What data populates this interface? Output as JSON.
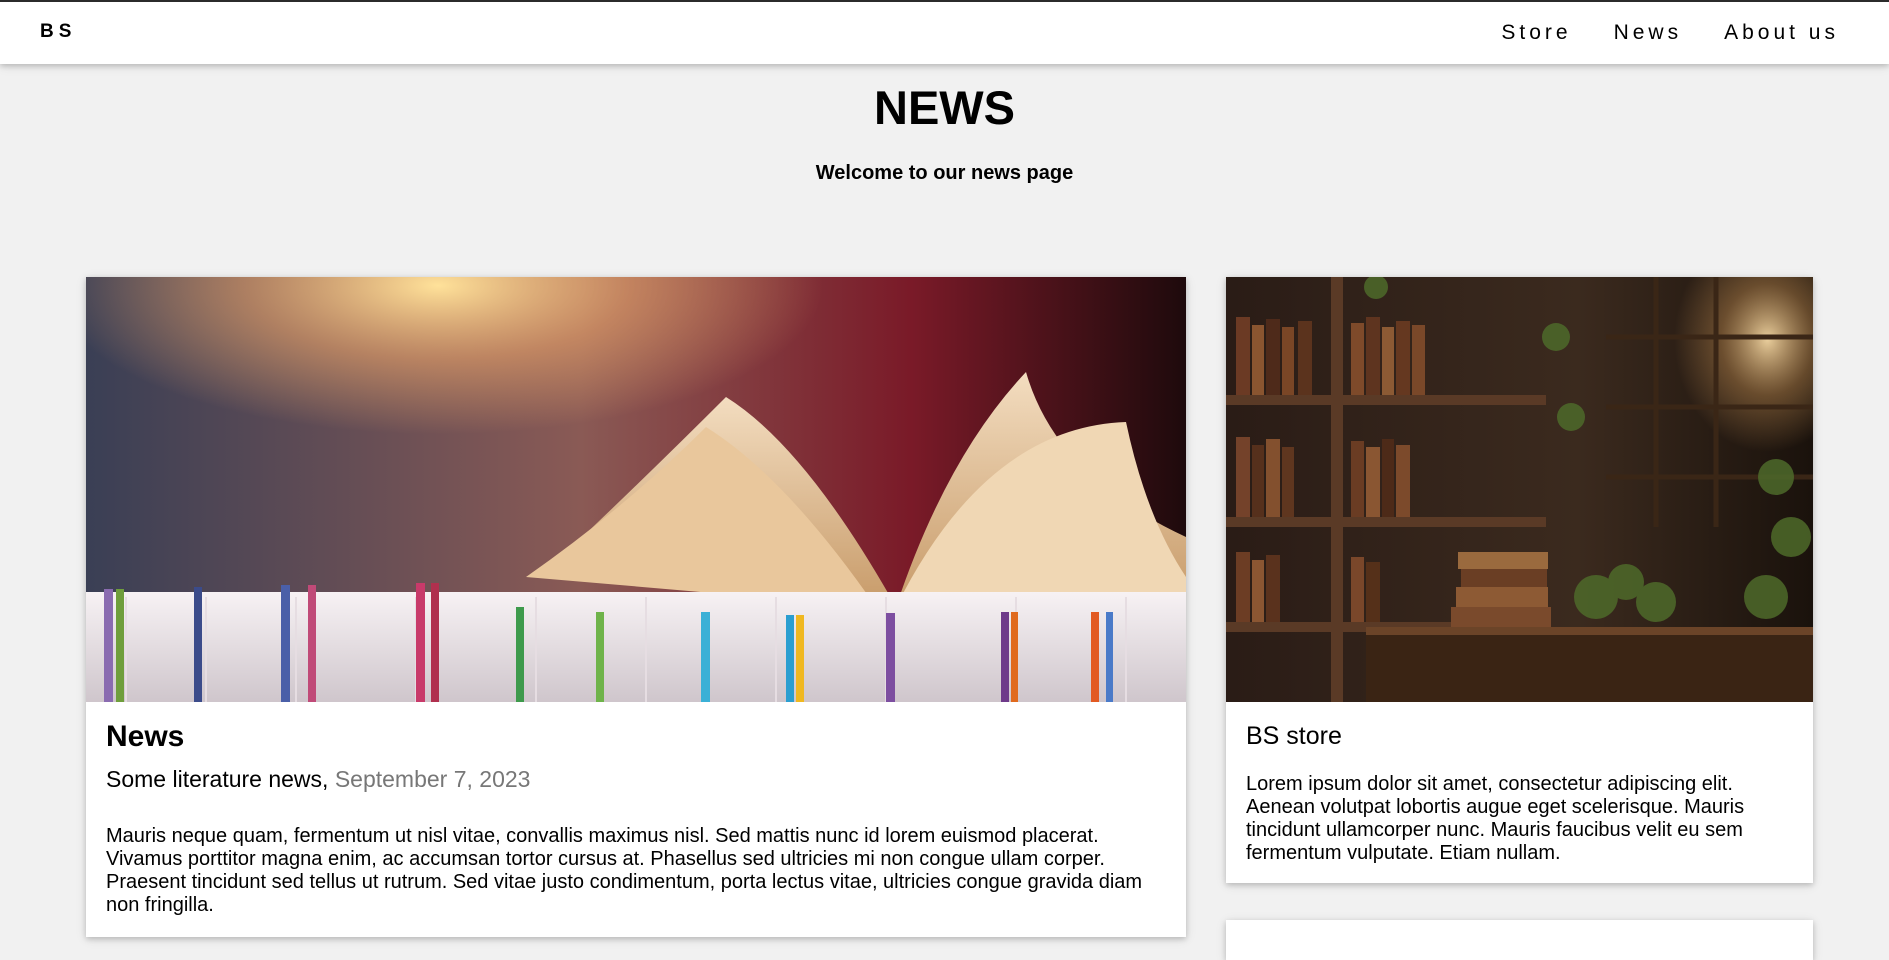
{
  "header": {
    "brand": "BS",
    "nav": [
      {
        "label": "Store"
      },
      {
        "label": "News"
      },
      {
        "label": "About us"
      }
    ]
  },
  "hero": {
    "title": "NEWS",
    "subtitle": "Welcome to our news page"
  },
  "main_card": {
    "image_icon": "open-book-photo",
    "title": "News",
    "subtitle": "Some literature news,",
    "date": "September 7, 2023",
    "text": "Mauris neque quam, fermentum ut nisl vitae, convallis maximus nisl. Sed mattis nunc id lorem euismod placerat. Vivamus porttitor magna enim, ac accumsan tortor cursus at. Phasellus sed ultricies mi non congue ullam corper. Praesent tincidunt sed tellus ut rutrum. Sed vitae justo condimentum, porta lectus vitae, ultricies congue gravida diam non fringilla."
  },
  "side_card": {
    "image_icon": "library-room-photo",
    "title": "BS store",
    "text": "Lorem ipsum dolor sit amet, consectetur adipiscing elit. Aenean volutpat lobortis augue eget scelerisque. Mauris tincidunt ullamcorper nunc. Mauris faucibus velit eu sem fermentum vulputate. Etiam nullam."
  }
}
